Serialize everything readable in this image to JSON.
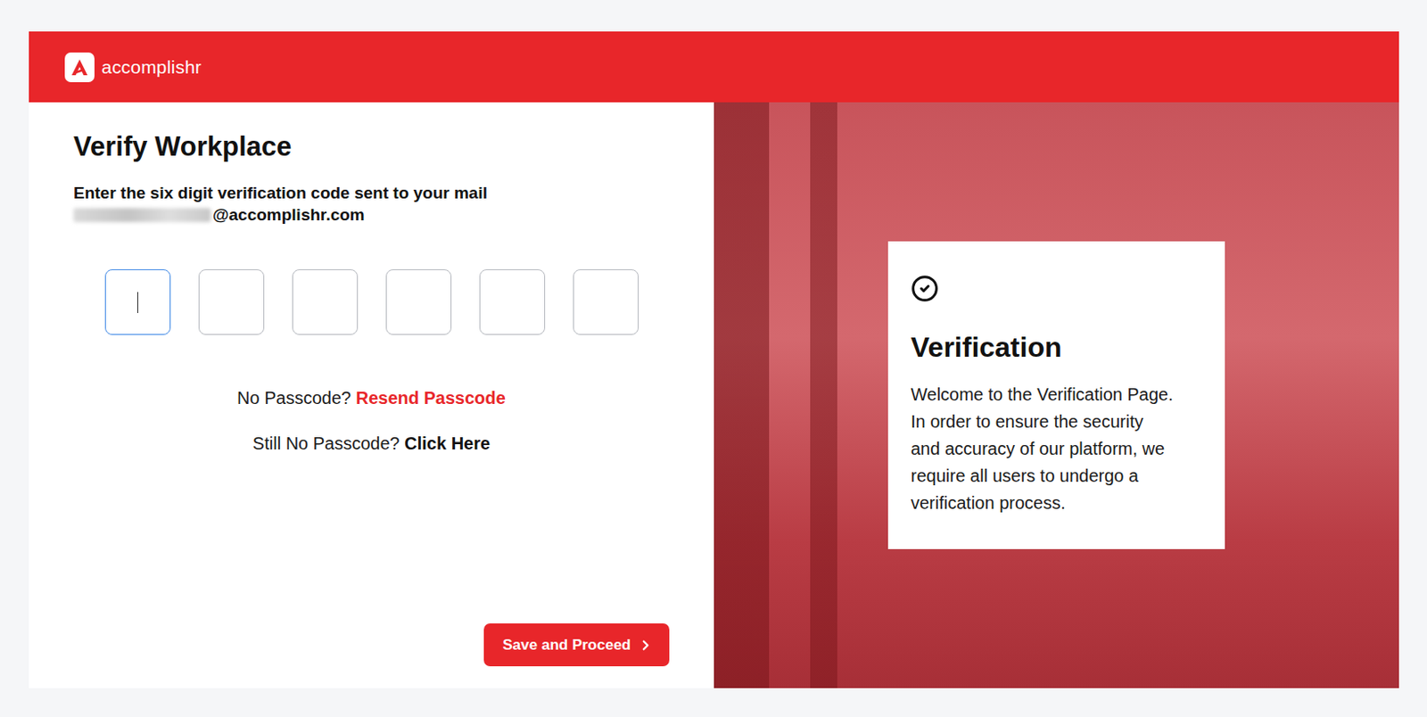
{
  "header": {
    "brand": "accomplishr"
  },
  "form": {
    "title": "Verify Workplace",
    "instruction": "Enter the six digit verification code sent to your mail",
    "email": {
      "local_part_blurred": true,
      "domain": "@accomplishr.com"
    },
    "code_boxes": [
      {
        "value": "",
        "focused": true
      },
      {
        "value": "",
        "focused": false
      },
      {
        "value": "",
        "focused": false
      },
      {
        "value": "",
        "focused": false
      },
      {
        "value": "",
        "focused": false
      },
      {
        "value": "",
        "focused": false
      }
    ],
    "resend": {
      "prompt": "No Passcode?",
      "link": "Resend Passcode"
    },
    "help": {
      "prompt": "Still No Passcode?",
      "link": "Click Here"
    },
    "submit": {
      "label": "Save and Proceed"
    }
  },
  "info_card": {
    "title": "Verification",
    "body_lines": [
      "Welcome to the Verification Page.",
      "In order to ensure the security",
      "and accuracy of our platform, we",
      "require all users to undergo a",
      "verification process."
    ]
  }
}
